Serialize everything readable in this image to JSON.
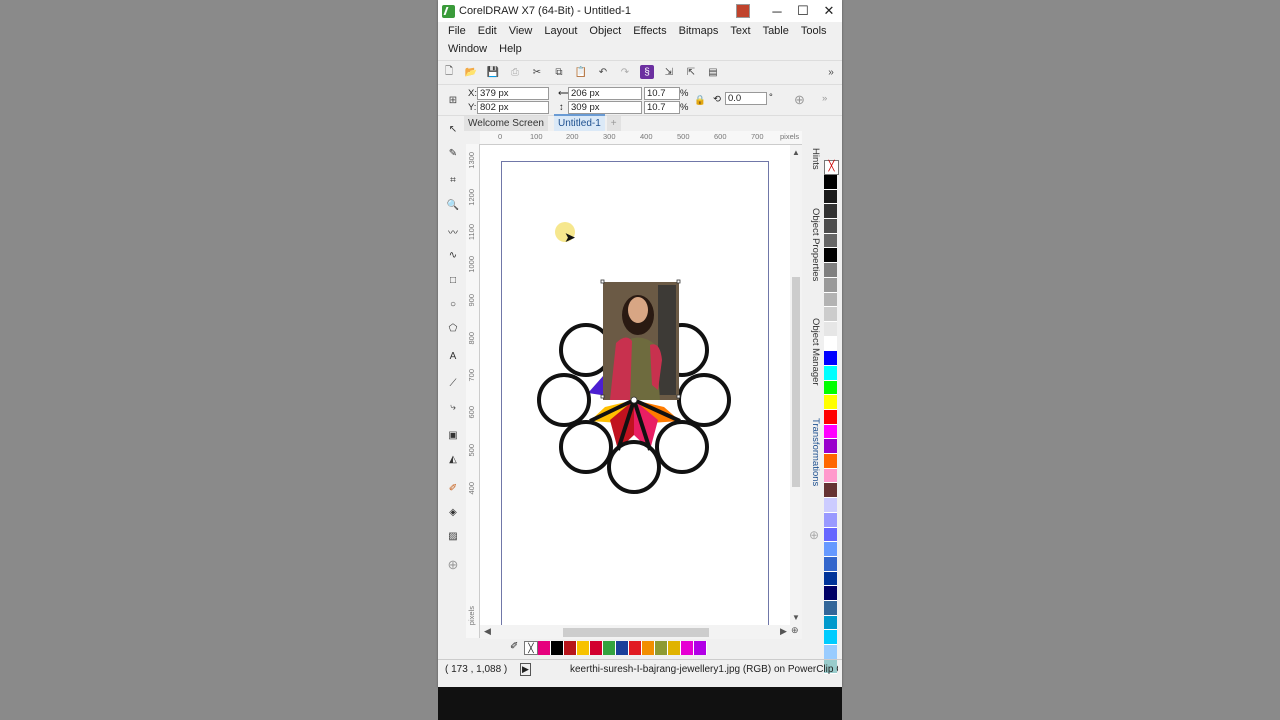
{
  "window": {
    "title": "CorelDRAW X7 (64-Bit) - Untitled-1",
    "controls": {
      "minimize": "─",
      "maximize": "☐",
      "close": "✕"
    }
  },
  "menu": [
    "File",
    "Edit",
    "View",
    "Layout",
    "Object",
    "Effects",
    "Bitmaps",
    "Text",
    "Table",
    "Tools",
    "Window",
    "Help"
  ],
  "property_bar": {
    "x_label": "X:",
    "x_value": "379 px",
    "y_label": "Y:",
    "y_value": "802 px",
    "width_value": "206 px",
    "height_value": "309 px",
    "scale_w": "10.7",
    "scale_h": "10.7",
    "pct": "%",
    "rotation_value": "0.0",
    "degree": "°"
  },
  "tabs": [
    {
      "label": "Welcome Screen",
      "active": false
    },
    {
      "label": "Untitled-1",
      "active": true
    }
  ],
  "ruler": {
    "h_ticks": [
      "0",
      "100",
      "200",
      "300",
      "400",
      "500",
      "600",
      "700"
    ],
    "h_unit": "pixels",
    "v_ticks": [
      "1300",
      "1200",
      "1100",
      "1000",
      "900",
      "800",
      "700",
      "600",
      "500",
      "400"
    ],
    "v_unit": "pixels"
  },
  "dockers": [
    "Hints",
    "Object Properties",
    "Object Manager",
    "Transformations"
  ],
  "palette_colors": [
    "#000000",
    "#1a1a1a",
    "#333333",
    "#4d4d4d",
    "#666666",
    "#000000",
    "#808080",
    "#999999",
    "#b3b3b3",
    "#cccccc",
    "#e6e6e6",
    "#ffffff",
    "#0000ff",
    "#00ffff",
    "#00ff00",
    "#ffff00",
    "#ff0000",
    "#ff00ff",
    "#9900cc",
    "#ff6600",
    "#ff99cc",
    "#663333",
    "#ccccff",
    "#9999ff",
    "#6666ff",
    "#6699ff",
    "#3366cc",
    "#003399",
    "#000066",
    "#336699",
    "#0099cc",
    "#00ccff",
    "#99ccff",
    "#99cccc"
  ],
  "document_palette": [
    "#e6007e",
    "#000000",
    "#b8151b",
    "#f7c200",
    "#d2002e",
    "#34a33f",
    "#1b3f9a",
    "#e11b22",
    "#f28e00",
    "#8e9a32",
    "#e0b300",
    "#e600d3",
    "#b200e6"
  ],
  "status": {
    "coords": "( 173 , 1,088 )",
    "object_info": "keerthi-suresh-I-bajrang-jewellery1.jpg (RGB) on PowerClip C"
  },
  "artwork": {
    "petal_colors": {
      "blue": "#4c1fd1",
      "yellow": "#ffbf00",
      "orange": "#ff7b00",
      "red": "#c1121f",
      "pink": "#e91e63",
      "outline": "#111111"
    }
  }
}
